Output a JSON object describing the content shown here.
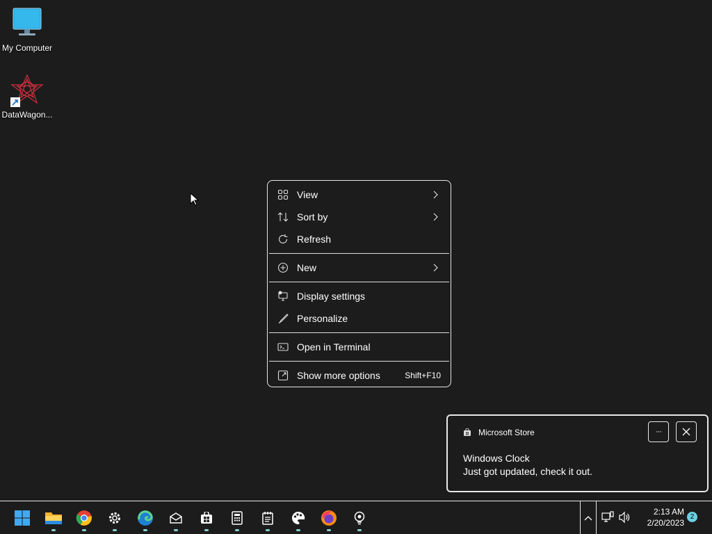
{
  "desktop": {
    "icons": [
      {
        "label": "My Computer",
        "icon": "monitor-icon"
      },
      {
        "label": "DataWagon...",
        "icon": "datawagon-logo-icon"
      }
    ]
  },
  "context_menu": {
    "items": [
      {
        "label": "View",
        "icon": "grid-icon",
        "submenu": true
      },
      {
        "label": "Sort by",
        "icon": "sort-icon",
        "submenu": true
      },
      {
        "label": "Refresh",
        "icon": "refresh-icon"
      },
      {
        "label": "New",
        "icon": "plus-circle-icon",
        "submenu": true
      },
      {
        "label": "Display settings",
        "icon": "display-icon"
      },
      {
        "label": "Personalize",
        "icon": "brush-icon"
      },
      {
        "label": "Open in Terminal",
        "icon": "terminal-icon"
      },
      {
        "label": "Show more options",
        "icon": "expand-icon",
        "shortcut": "Shift+F10"
      }
    ]
  },
  "notification": {
    "source": "Microsoft Store",
    "title": "Windows Clock",
    "body": "Just got updated, check it out.",
    "more_label": "···"
  },
  "taskbar": {
    "apps": [
      "start-icon",
      "file-explorer-icon",
      "chrome-icon",
      "settings-icon",
      "edge-icon",
      "mail-icon",
      "store-icon",
      "calculator-icon",
      "notepad-icon",
      "paint-icon",
      "firefox-icon",
      "tips-icon"
    ],
    "time": "2:13 AM",
    "date": "2/20/2023",
    "notification_count": "2"
  },
  "colors": {
    "background": "#1c1c1c",
    "accent": "#6ad1e3"
  }
}
